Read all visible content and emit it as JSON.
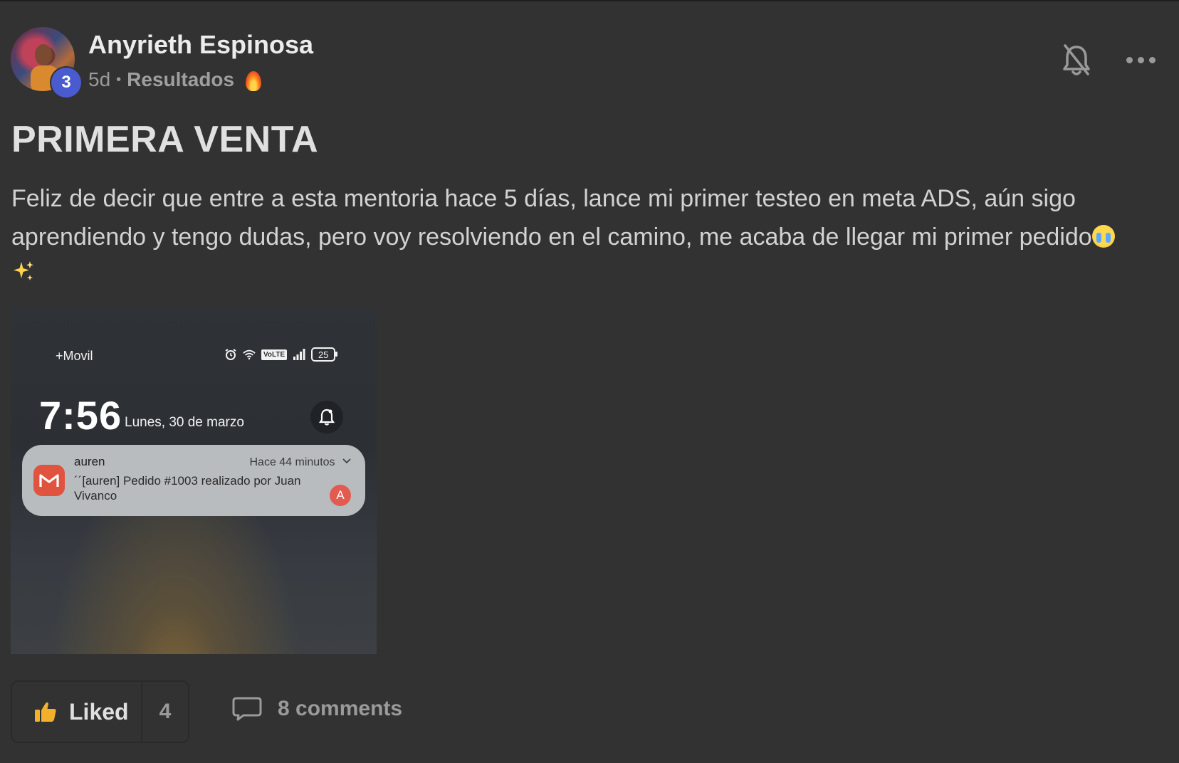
{
  "post": {
    "author": "Anyrieth Espinosa",
    "level": "3",
    "age": "5d",
    "separator": "•",
    "category": "Resultados",
    "category_icon": "fire-emoji",
    "title": "PRIMERA VENTA",
    "body": "Feliz de decir que entre a esta mentoria hace 5 días, lance mi primer testeo en meta ADS, aún sigo aprendiendo y tengo dudas, pero voy resolviendo en el camino, me acaba de llegar mi primer pedido",
    "body_emojis": [
      "crying-face-emoji",
      "sparkles-emoji"
    ]
  },
  "header_actions": {
    "notify_icon": "bell-off-icon",
    "more_icon": "more-horizontal-icon"
  },
  "attachment": {
    "carrier": "+Movil",
    "battery": "25",
    "volte": "VoLTE",
    "time": "7:56",
    "date": "Lunes, 30 de marzo",
    "notification": {
      "app": "auren",
      "when": "Hace 44 minutos",
      "message": "´´[auren] Pedido #1003  realizado por Juan Vivanco",
      "avatar_letter": "A"
    }
  },
  "actions": {
    "like_label": "Liked",
    "like_count": "4",
    "comments_label": "8 comments"
  },
  "colors": {
    "background": "#323232",
    "level_badge": "#4a5bd0",
    "gmail_red": "#e0533f"
  }
}
